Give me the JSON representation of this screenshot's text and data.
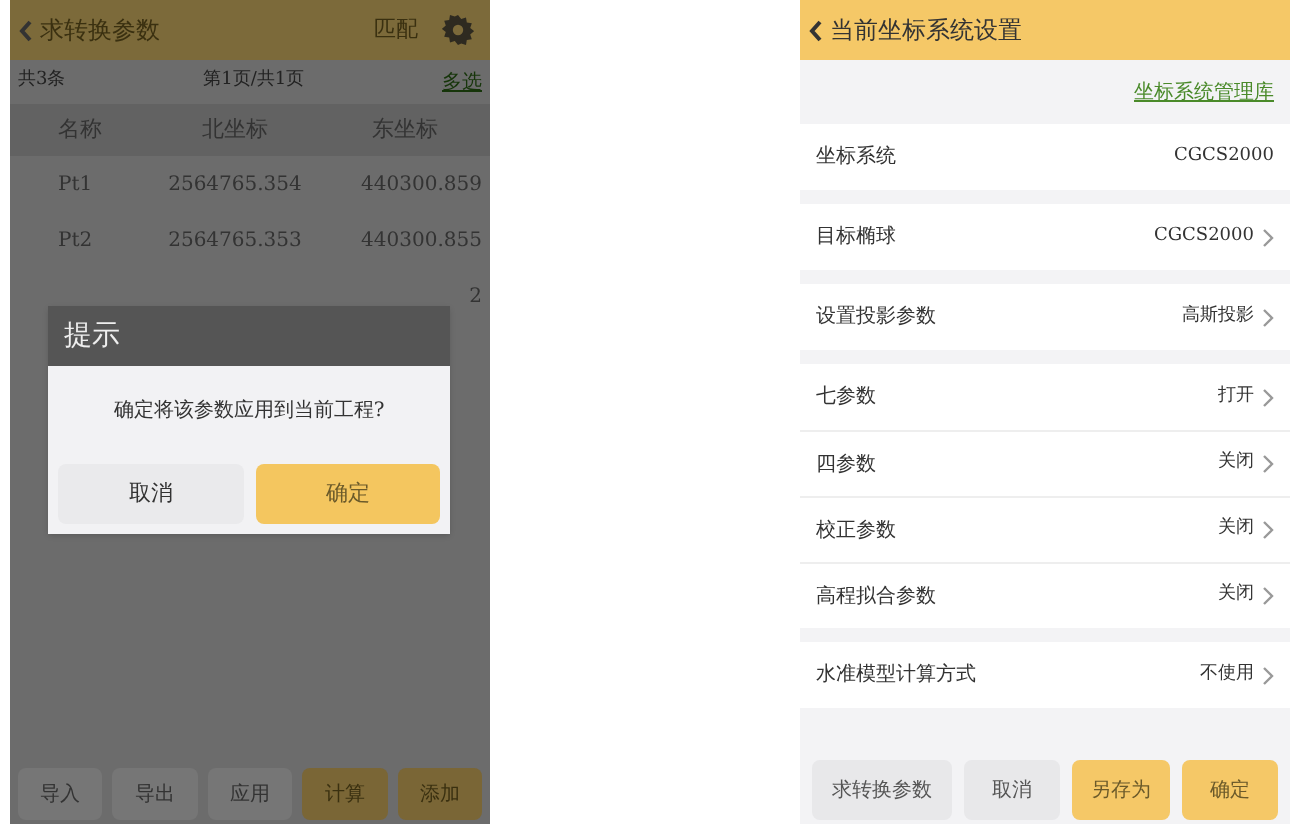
{
  "left_screen": {
    "title": "求转换参数",
    "match_button": "匹配",
    "info": {
      "count": "共3条",
      "page": "第1页/共1页",
      "multi_select": "多选"
    },
    "table": {
      "columns": [
        "名称",
        "北坐标",
        "东坐标"
      ],
      "rows": [
        {
          "name": "Pt1",
          "north": "2564765.354",
          "east": "440300.859"
        },
        {
          "name": "Pt2",
          "north": "2564765.353",
          "east": "440300.855"
        },
        {
          "east": "2"
        }
      ]
    },
    "dialog": {
      "title": "提示",
      "message": "确定将该参数应用到当前工程?",
      "buttons": [
        {
          "label": "取消",
          "kind": "secondary"
        },
        {
          "label": "确定",
          "kind": "primary"
        }
      ]
    },
    "toolbar": [
      {
        "label": "导入",
        "kind": "secondary"
      },
      {
        "label": "导出",
        "kind": "secondary"
      },
      {
        "label": "应用",
        "kind": "secondary"
      },
      {
        "label": "计算",
        "kind": "primary"
      },
      {
        "label": "添加",
        "kind": "primary"
      }
    ]
  },
  "right_screen": {
    "title": "当前坐标系统设置",
    "library_link": "坐标系统管理库",
    "groups": [
      [
        {
          "label": "坐标系统",
          "value": "CGCS2000",
          "chevron": false
        }
      ],
      [
        {
          "label": "目标椭球",
          "value": "CGCS2000",
          "chevron": true
        }
      ],
      [
        {
          "label": "设置投影参数",
          "value": "高斯投影",
          "chevron": true
        }
      ],
      [
        {
          "label": "七参数",
          "value": "打开",
          "chevron": true
        },
        {
          "label": "四参数",
          "value": "关闭",
          "chevron": true
        },
        {
          "label": "校正参数",
          "value": "关闭",
          "chevron": true
        },
        {
          "label": "高程拟合参数",
          "value": "关闭",
          "chevron": true
        }
      ],
      [
        {
          "label": "水准模型计算方式",
          "value": "不使用",
          "chevron": true
        }
      ]
    ],
    "buttons": [
      {
        "label": "求转换参数",
        "kind": "secondary"
      },
      {
        "label": "取消",
        "kind": "secondary"
      },
      {
        "label": "另存为",
        "kind": "primary"
      },
      {
        "label": "确定",
        "kind": "primary"
      }
    ]
  }
}
